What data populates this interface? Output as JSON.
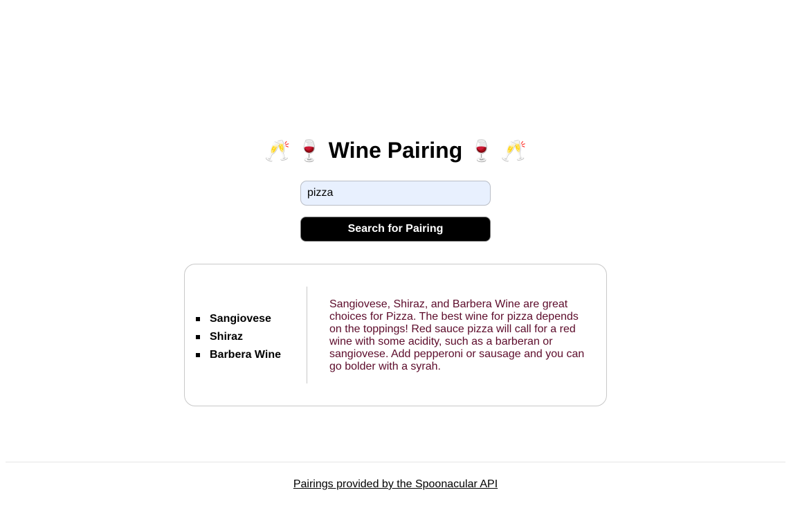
{
  "header": {
    "title": "Wine Pairing",
    "emoji_left_outer": "🥂",
    "emoji_left_inner": "🍷",
    "emoji_right_inner": "🍷",
    "emoji_right_outer": "🥂"
  },
  "search": {
    "value": "pizza",
    "button_label": "Search for Pairing"
  },
  "results": {
    "wines": [
      "Sangiovese",
      "Shiraz",
      "Barbera Wine"
    ],
    "description": "Sangiovese, Shiraz, and Barbera Wine are great choices for Pizza. The best wine for pizza depends on the toppings! Red sauce pizza will call for a red wine with some acidity, such as a barberan or sangiovese. Add pepperoni or sausage and you can go bolder with a syrah."
  },
  "footer": {
    "link_text": "Pairings provided by the Spoonacular API"
  },
  "colors": {
    "description_text": "#5c0b2a",
    "input_background": "#e8f0fe",
    "button_background": "#000000"
  }
}
